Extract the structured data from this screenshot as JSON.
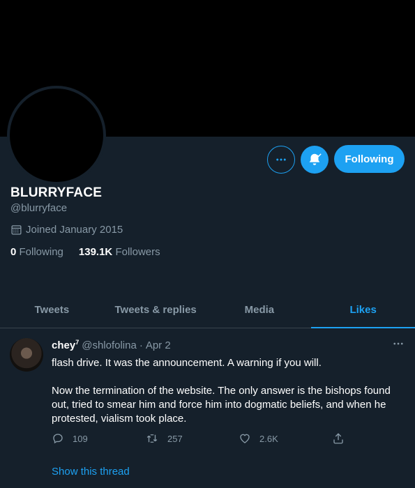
{
  "profile": {
    "display_name": "BLURRYFACE",
    "handle": "@blurryface",
    "joined": "Joined January 2015",
    "following_count": "0",
    "following_label": "Following",
    "followers_count": "139.1K",
    "followers_label": "Followers",
    "follow_button_label": "Following"
  },
  "tabs": [
    {
      "label": "Tweets"
    },
    {
      "label": "Tweets & replies"
    },
    {
      "label": "Media"
    },
    {
      "label": "Likes",
      "active": true
    }
  ],
  "tweet": {
    "author_name": "chey",
    "author_superscript": "7",
    "author_handle": "@shlofolina",
    "separator": "·",
    "date": "Apr 2",
    "paragraph_1": "flash drive. It was the announcement. A warning if you will.",
    "paragraph_2": "Now the termination of the website. The only answer is the bishops found out, tried to smear him and force him into dogmatic beliefs, and when he protested, vialism took place.",
    "reply_count": "109",
    "retweet_count": "257",
    "like_count": "2.6K",
    "show_thread_label": "Show this thread"
  },
  "colors": {
    "background": "#15202b",
    "accent": "#1da1f2",
    "secondary_text": "#8899a6",
    "banner": "#000000"
  },
  "icons": {
    "more": "more-horizontal-icon",
    "bell": "bell-notification-icon",
    "calendar": "calendar-icon",
    "reply": "reply-icon",
    "retweet": "retweet-icon",
    "like": "heart-icon",
    "share": "share-icon"
  }
}
